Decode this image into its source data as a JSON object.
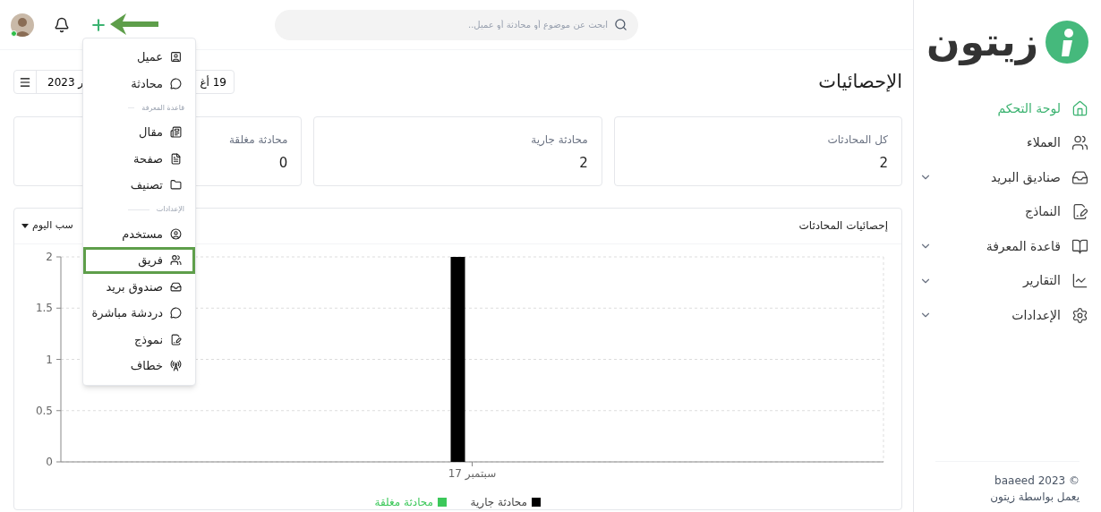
{
  "sidebar": {
    "logo": "زيتون",
    "items": [
      {
        "label": "لوحة التحكم",
        "selected": true,
        "expandable": false
      },
      {
        "label": "العملاء",
        "selected": false,
        "expandable": false
      },
      {
        "label": "صناديق البريد",
        "selected": false,
        "expandable": true
      },
      {
        "label": "النماذج",
        "selected": false,
        "expandable": false
      },
      {
        "label": "قاعدة المعرفة",
        "selected": false,
        "expandable": true
      },
      {
        "label": "التقارير",
        "selected": false,
        "expandable": true
      },
      {
        "label": "الإعدادات",
        "selected": false,
        "expandable": true
      }
    ],
    "footer": [
      "© baaeed 2023",
      "يعمل بواسطة زيتون"
    ]
  },
  "header": {
    "search": {
      "placeholder": "ابحث عن موضوع أو محادثة أو عميل.."
    },
    "online": true
  },
  "add_menu": {
    "items": [
      {
        "kind": "item",
        "label": "عميل",
        "highlighted": false
      },
      {
        "kind": "item",
        "label": "محادثة",
        "highlighted": false
      },
      {
        "kind": "header",
        "label": "قاعدة المعرفة"
      },
      {
        "kind": "item",
        "label": "مقال",
        "highlighted": false
      },
      {
        "kind": "item",
        "label": "صفحة",
        "highlighted": false
      },
      {
        "kind": "item",
        "label": "تصنيف",
        "highlighted": false
      },
      {
        "kind": "header",
        "label": "الإعدادات"
      },
      {
        "kind": "item",
        "label": "مستخدم",
        "highlighted": false
      },
      {
        "kind": "item",
        "label": "فريق",
        "highlighted": true
      },
      {
        "kind": "item",
        "label": "صندوق بريد",
        "highlighted": false
      },
      {
        "kind": "item",
        "label": "دردشة مباشرة",
        "highlighted": false
      },
      {
        "kind": "item",
        "label": "نموذج",
        "highlighted": false
      },
      {
        "kind": "item",
        "label": "خطاف",
        "highlighted": false
      }
    ]
  },
  "page": {
    "title": "الإحصائيات",
    "date_range": {
      "start_part": "19 أغ",
      "end_part": "ر 2023"
    }
  },
  "stats": [
    {
      "label": "كل المحادثات",
      "value": "2"
    },
    {
      "label": "محادثة جارية",
      "value": "2"
    },
    {
      "label": "محادثة مغلقة",
      "value": "0"
    }
  ],
  "chart_card": {
    "title": "إحصائيات المحادثات",
    "period": "سب اليوم",
    "chart_data": {
      "type": "bar",
      "categories": [
        "17 سبتمبر"
      ],
      "series": [
        {
          "name": "محادثة جارية",
          "color": "#000000",
          "values": [
            2
          ]
        },
        {
          "name": "محادثة مغلقة",
          "color": "#3cc85a",
          "values": [
            0
          ]
        }
      ],
      "grid": true,
      "ylim": [
        0,
        2
      ],
      "yticks": [
        0,
        0.5,
        1,
        1.5,
        2
      ]
    }
  }
}
